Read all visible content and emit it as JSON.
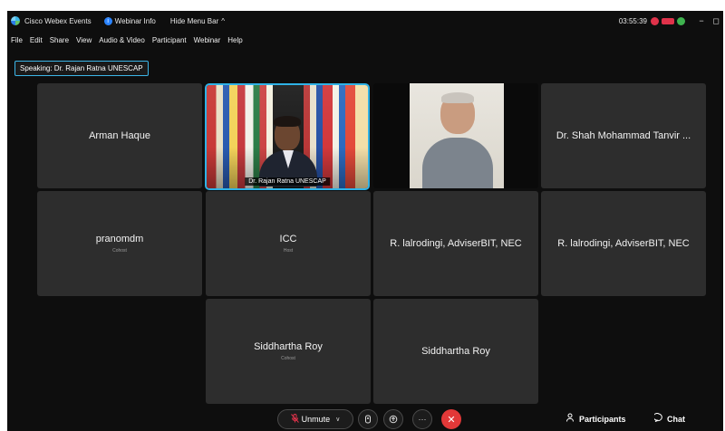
{
  "titlebar": {
    "app_name": "Cisco Webex Events",
    "webinar_info": "Webinar Info",
    "hide_menu": "Hide Menu Bar",
    "caret": "^",
    "clock": "03:55:39",
    "min": "−",
    "max": "◻",
    "close": "✕"
  },
  "menu": [
    "File",
    "Edit",
    "Share",
    "View",
    "Audio & Video",
    "Participant",
    "Webinar",
    "Help"
  ],
  "speaking": "Speaking: Dr. Rajan Ratna UNESCAP",
  "tiles": [
    {
      "name": "Arman Haque",
      "sub": ""
    },
    {
      "name": "Dr. Rajan Ratna UNESCAP",
      "sub": ""
    },
    {
      "name": "",
      "sub": ""
    },
    {
      "name": "Dr. Shah Mohammad Tanvir ...",
      "sub": ""
    },
    {
      "name": "pranomdm",
      "sub": "Cohost"
    },
    {
      "name": "ICC",
      "sub": "Host"
    },
    {
      "name": "R. lalrodingi, AdviserBIT, NEC",
      "sub": ""
    },
    {
      "name": "R. lalrodingi, AdviserBIT, NEC",
      "sub": ""
    },
    {
      "name": "Siddhartha Roy",
      "sub": "Cohost"
    },
    {
      "name": "Siddhartha Roy",
      "sub": ""
    }
  ],
  "controls": {
    "unmute": "Unmute",
    "participants": "Participants",
    "chat": "Chat",
    "more": "···"
  },
  "colors": {
    "accent": "#2fb2e6",
    "leave": "#e23838",
    "tile": "#2d2d2d",
    "background": "#0e0e0e"
  }
}
